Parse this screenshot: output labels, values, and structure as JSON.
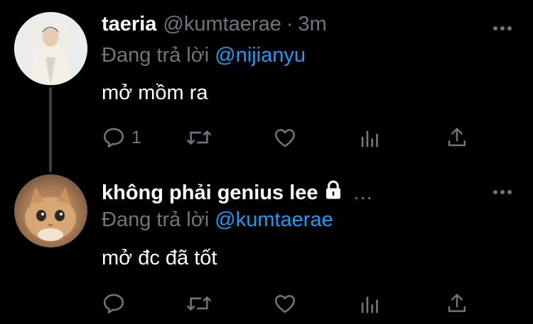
{
  "tweet1": {
    "name": "taeria",
    "handle": "@kumtaerae",
    "separator": "·",
    "time": "3m",
    "replying_prefix": "Đang trả lời",
    "replying_to": "@nijianyu",
    "text": "mở mồm ra",
    "reply_count": "1",
    "avatar_icon": "avatar-person-photo"
  },
  "tweet2": {
    "name": "không phải genius lee",
    "inline_more": "...",
    "replying_prefix": "Đang trả lời",
    "replying_to": "@kumtaerae",
    "text": "mở đc đã tốt",
    "avatar_icon": "avatar-cat-photo",
    "locked_icon": "lock-icon"
  },
  "icons": [
    "reply-icon",
    "retweet-icon",
    "like-icon",
    "analytics-icon",
    "share-icon",
    "more-icon"
  ],
  "colors": {
    "background": "#000000",
    "secondary": "#6e767d",
    "accent": "#1d9bf0",
    "thread_line": "#3a3d41"
  }
}
